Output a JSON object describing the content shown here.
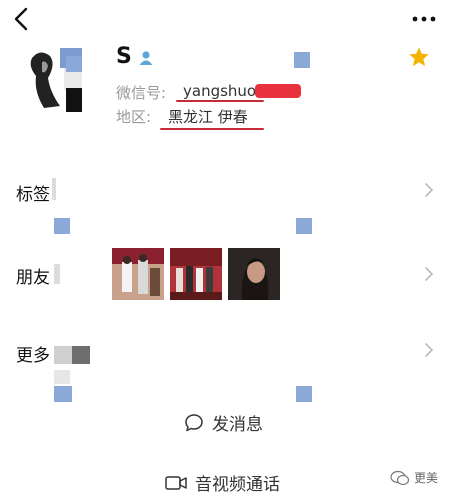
{
  "profile": {
    "name": "S",
    "wechat_id_label": "微信号:",
    "wechat_id_value": "yangshuo",
    "region_label": "地区:",
    "region_value": "黑龙江 伊春"
  },
  "rows": {
    "tags_label": "标签",
    "moments_label": "朋友",
    "more_label": "更多"
  },
  "actions": {
    "send_message": "发消息",
    "av_call": "音视频通话"
  },
  "watermark": "更美",
  "icons": [
    "back-arrow-icon",
    "more-icon",
    "gender-icon",
    "star-icon",
    "chevron-right-icon",
    "message-bubble-icon",
    "video-camera-icon"
  ],
  "colors": {
    "accent_red": "#c82a3a",
    "star_gold": "#f5b301",
    "mosaic_blue": "#8ba9d8"
  }
}
